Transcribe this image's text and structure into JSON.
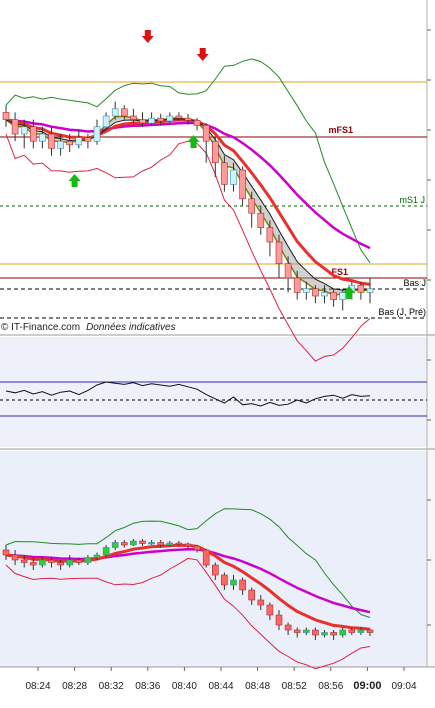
{
  "chart_data": {
    "type": "line",
    "x_ticks": [
      "08:24",
      "08:28",
      "08:32",
      "08:36",
      "08:40",
      "08:44",
      "08:48",
      "08:52",
      "08:56",
      "09:00",
      "09:04"
    ],
    "current_time": "09:00",
    "watermark": "IT-Finance.com",
    "watermark_note": "Données indicatives",
    "levels": [
      {
        "label": "mFS1",
        "color": "#8b0000",
        "style": "solid"
      },
      {
        "label": "mS1 J",
        "color": "#006400",
        "style": "dashed"
      },
      {
        "label": "FS1",
        "color": "#8b0000",
        "style": "solid"
      },
      {
        "label": "Bas J",
        "color": "#000000",
        "style": "dashed"
      },
      {
        "label": "Bas (J, Pré)",
        "color": "#000000",
        "style": "dashed"
      }
    ],
    "signals": [
      {
        "type": "sell",
        "time": "08:36"
      },
      {
        "type": "sell",
        "time": "08:42"
      },
      {
        "type": "buy",
        "time": "08:28"
      },
      {
        "type": "buy",
        "time": "08:41"
      },
      {
        "type": "buy",
        "time": "08:58"
      }
    ],
    "candles_top": [
      {
        "o": 8,
        "c": 7,
        "h": 9,
        "l": 6
      },
      {
        "o": 7,
        "c": 5,
        "h": 8,
        "l": 4
      },
      {
        "o": 5,
        "c": 6,
        "h": 7,
        "l": 3
      },
      {
        "o": 6,
        "c": 4,
        "h": 7,
        "l": 3
      },
      {
        "o": 4,
        "c": 5,
        "h": 6,
        "l": 3
      },
      {
        "o": 5,
        "c": 3,
        "h": 6,
        "l": 2
      },
      {
        "o": 3,
        "c": 4,
        "h": 5,
        "l": 2
      },
      {
        "o": 4,
        "c": 3.5,
        "h": 5,
        "l": 2.5
      },
      {
        "o": 3.5,
        "c": 4.5,
        "h": 5.5,
        "l": 3
      },
      {
        "o": 4.5,
        "c": 4,
        "h": 5,
        "l": 3
      },
      {
        "o": 4,
        "c": 6,
        "h": 7,
        "l": 3.5
      },
      {
        "o": 6,
        "c": 7.5,
        "h": 8,
        "l": 5.5
      },
      {
        "o": 7.5,
        "c": 8.5,
        "h": 9.5,
        "l": 7
      },
      {
        "o": 8.5,
        "c": 7.5,
        "h": 9,
        "l": 7
      },
      {
        "o": 7.5,
        "c": 7,
        "h": 8.5,
        "l": 6.5
      },
      {
        "o": 7,
        "c": 6.5,
        "h": 8,
        "l": 6
      },
      {
        "o": 6.5,
        "c": 7.2,
        "h": 8,
        "l": 6.2
      },
      {
        "o": 7.2,
        "c": 6.8,
        "h": 7.8,
        "l": 6.2
      },
      {
        "o": 6.8,
        "c": 7.5,
        "h": 8,
        "l": 6.5
      },
      {
        "o": 7.5,
        "c": 7.2,
        "h": 8,
        "l": 6.8
      },
      {
        "o": 7.2,
        "c": 6.9,
        "h": 7.8,
        "l": 6.3
      },
      {
        "o": 6.9,
        "c": 6.2,
        "h": 7.2,
        "l": 5.5
      },
      {
        "o": 6.2,
        "c": 4,
        "h": 6.5,
        "l": 1
      },
      {
        "o": 4,
        "c": 1,
        "h": 4.5,
        "l": -1
      },
      {
        "o": 1,
        "c": -2,
        "h": 2,
        "l": -3
      },
      {
        "o": -2,
        "c": 0,
        "h": 1,
        "l": -3
      },
      {
        "o": 0,
        "c": -4,
        "h": 0.5,
        "l": -5
      },
      {
        "o": -4,
        "c": -6,
        "h": -3,
        "l": -8
      },
      {
        "o": -6,
        "c": -8,
        "h": -5,
        "l": -9
      },
      {
        "o": -8,
        "c": -10,
        "h": -7,
        "l": -12
      },
      {
        "o": -10,
        "c": -13,
        "h": -9,
        "l": -15
      },
      {
        "o": -13,
        "c": -15,
        "h": -12,
        "l": -17
      },
      {
        "o": -15,
        "c": -17,
        "h": -14,
        "l": -18
      },
      {
        "o": -17,
        "c": -16.5,
        "h": -15.5,
        "l": -18
      },
      {
        "o": -16.5,
        "c": -17.5,
        "h": -16,
        "l": -18.5
      },
      {
        "o": -17.5,
        "c": -17,
        "h": -16,
        "l": -18.5
      },
      {
        "o": -17,
        "c": -18,
        "h": -16.5,
        "l": -19
      },
      {
        "o": -18,
        "c": -17,
        "h": -16.5,
        "l": -19.5
      },
      {
        "o": -17,
        "c": -16,
        "h": -15.5,
        "l": -18
      },
      {
        "o": -16,
        "c": -17,
        "h": -15.5,
        "l": -18
      },
      {
        "o": -17,
        "c": -16.5,
        "h": -15,
        "l": -18.5
      }
    ],
    "candles_bottom": [
      {
        "o": 5,
        "c": 4,
        "h": 6,
        "l": 3
      },
      {
        "o": 4,
        "c": 3,
        "h": 5,
        "l": 2
      },
      {
        "o": 3,
        "c": 2.5,
        "h": 4,
        "l": 1.5
      },
      {
        "o": 2.5,
        "c": 2,
        "h": 3.5,
        "l": 1
      },
      {
        "o": 2,
        "c": 3,
        "h": 3.5,
        "l": 1.5
      },
      {
        "o": 3,
        "c": 2.5,
        "h": 3.5,
        "l": 1.5
      },
      {
        "o": 2.5,
        "c": 2,
        "h": 3,
        "l": 1
      },
      {
        "o": 2,
        "c": 3,
        "h": 4,
        "l": 1.5
      },
      {
        "o": 3,
        "c": 2.5,
        "h": 3.5,
        "l": 2
      },
      {
        "o": 2.5,
        "c": 3.5,
        "h": 4,
        "l": 2
      },
      {
        "o": 3.5,
        "c": 4,
        "h": 4.5,
        "l": 3
      },
      {
        "o": 4,
        "c": 5.5,
        "h": 6,
        "l": 3.5
      },
      {
        "o": 5.5,
        "c": 6.5,
        "h": 7,
        "l": 5
      },
      {
        "o": 6.5,
        "c": 6,
        "h": 7,
        "l": 5.5
      },
      {
        "o": 6,
        "c": 6.8,
        "h": 7.2,
        "l": 5.8
      },
      {
        "o": 6.8,
        "c": 6.3,
        "h": 7.2,
        "l": 5.8
      },
      {
        "o": 6.3,
        "c": 6.5,
        "h": 7,
        "l": 6
      },
      {
        "o": 6.5,
        "c": 6,
        "h": 7,
        "l": 5.5
      },
      {
        "o": 6,
        "c": 6.4,
        "h": 6.8,
        "l": 5.6
      },
      {
        "o": 6.4,
        "c": 6.2,
        "h": 6.8,
        "l": 5.8
      },
      {
        "o": 6.2,
        "c": 5.8,
        "h": 6.5,
        "l": 5.2
      },
      {
        "o": 5.8,
        "c": 5,
        "h": 6,
        "l": 4.5
      },
      {
        "o": 5,
        "c": 2,
        "h": 5.2,
        "l": 1.5
      },
      {
        "o": 2,
        "c": 0,
        "h": 2.5,
        "l": -1
      },
      {
        "o": 0,
        "c": -2,
        "h": 0.5,
        "l": -3
      },
      {
        "o": -2,
        "c": -1,
        "h": 0,
        "l": -3
      },
      {
        "o": -1,
        "c": -3,
        "h": -0.5,
        "l": -4
      },
      {
        "o": -3,
        "c": -5,
        "h": -2.5,
        "l": -6
      },
      {
        "o": -5,
        "c": -6,
        "h": -4,
        "l": -7
      },
      {
        "o": -6,
        "c": -8,
        "h": -5.5,
        "l": -9
      },
      {
        "o": -8,
        "c": -10,
        "h": -7,
        "l": -11
      },
      {
        "o": -10,
        "c": -11,
        "h": -9.5,
        "l": -12
      },
      {
        "o": -11,
        "c": -11.5,
        "h": -10.5,
        "l": -12.5
      },
      {
        "o": -11.5,
        "c": -11,
        "h": -10.5,
        "l": -12
      },
      {
        "o": -11,
        "c": -12,
        "h": -10.5,
        "l": -13
      },
      {
        "o": -12,
        "c": -11.5,
        "h": -11,
        "l": -12.5
      },
      {
        "o": -11.5,
        "c": -12,
        "h": -11,
        "l": -13
      },
      {
        "o": -12,
        "c": -11,
        "h": -10.5,
        "l": -12.5
      },
      {
        "o": -11,
        "c": -11.5,
        "h": -10.5,
        "l": -12
      },
      {
        "o": -11.5,
        "c": -11,
        "h": -10.5,
        "l": -12
      },
      {
        "o": -11,
        "c": -11.5,
        "h": -10.8,
        "l": -12.2
      }
    ],
    "oscillator": [
      1.5,
      1.2,
      1.6,
      1.0,
      1.4,
      0.8,
      1.3,
      1.5,
      0.9,
      1.6,
      2.5,
      3.0,
      2.8,
      2.6,
      2.9,
      2.4,
      2.7,
      2.5,
      2.3,
      2.6,
      2.2,
      1.8,
      0.9,
      0.2,
      -0.5,
      0.5,
      -0.8,
      -0.6,
      -1.0,
      -0.4,
      -0.9,
      -0.7,
      0.0,
      -0.5,
      0.2,
      0.6,
      0.8,
      0.3,
      0.9,
      0.6,
      0.7
    ],
    "colors": {
      "bull": "#ccf2ff",
      "bear": "#ff9a9a",
      "bull_bottom": "#33cc33",
      "bear_bottom": "#ff6666",
      "ema_red": "#e8312a",
      "ema_magenta": "#cc00cc",
      "band_green": "#228b22",
      "band_red": "#dd2244",
      "kumo_fill": "#9a9a9a"
    }
  }
}
